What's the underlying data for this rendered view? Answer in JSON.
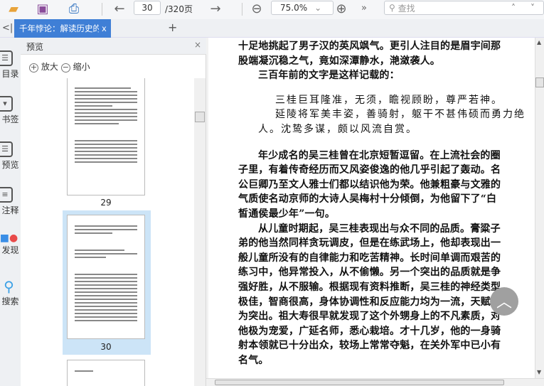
{
  "toolbar": {
    "page_current": "30",
    "page_total": "/320页",
    "zoom": "75.0%",
    "search_placeholder": "查找",
    "more": "»"
  },
  "tab": {
    "title": "千年悖论：解读历史的另一种方式",
    "close": "x",
    "add": "+",
    "collapse": "<|"
  },
  "rail": [
    {
      "label": "目录"
    },
    {
      "label": "书签"
    },
    {
      "label": "预览"
    },
    {
      "label": "注释"
    },
    {
      "label": "发现"
    },
    {
      "label": "搜索"
    }
  ],
  "panel": {
    "title": "预览",
    "close": "×",
    "zoom_in": "放大",
    "zoom_out": "缩小",
    "pages": [
      "29",
      "30"
    ]
  },
  "doc": {
    "lines": [
      "十足地挑起了男子汉的英风飒气。更引人注目的是眉宇间那",
      "股端凝沉稳之气，竟如深潭静水，滟潋袭人。",
      "三百年前的文字是这样记载的：",
      "三桂巨耳隆准，无须，瞻视顾盼，尊严若神。",
      "延陵将军美丰姿，善骑射，躯干不甚伟硕而勇力绝",
      "人。沈鸷多谋，颇以风流自赏。",
      "年少成名的吴三桂曾在北京短暂逗留。在上流社会的圈",
      "子里，有着传奇经历而又风姿俊逸的他几乎引起了轰动。名",
      "公巨卿乃至文人雅士们都以结识他为荣。他兼粗豪与文雅的",
      "气质使名动京师的大诗人吴梅村十分倾倒，为他留下了“白",
      "皙通侯最少年”一句。",
      "从儿童时期起，吴三桂表现出与众不同的品质。膏粱子",
      "弟的他当然同样贪玩调皮，但是在练武场上，他却表现出一",
      "般儿童所没有的自律能力和吃苦精神。长时间单调而艰苦的",
      "练习中，他异常投入，从不偷懒。另一个突出的品质就是争",
      "强好胜，从不服输。根据现有资料推断，吴三桂的神经类型",
      "极佳，智商很高，身体协调性和反应能力均为一流，天赋极",
      "为突出。祖大寿很早就发现了这个外甥身上的不凡素质，对",
      "他极为宠爱，广延名师，悉心栽培。才十几岁，他的一身骑",
      "射本领就已十分出众，较场上常常夺魁，在关外军中已小有",
      "名气。"
    ]
  },
  "colors": {
    "accent": "#3f7fd6",
    "selected_thumb": "#cce4f7"
  }
}
